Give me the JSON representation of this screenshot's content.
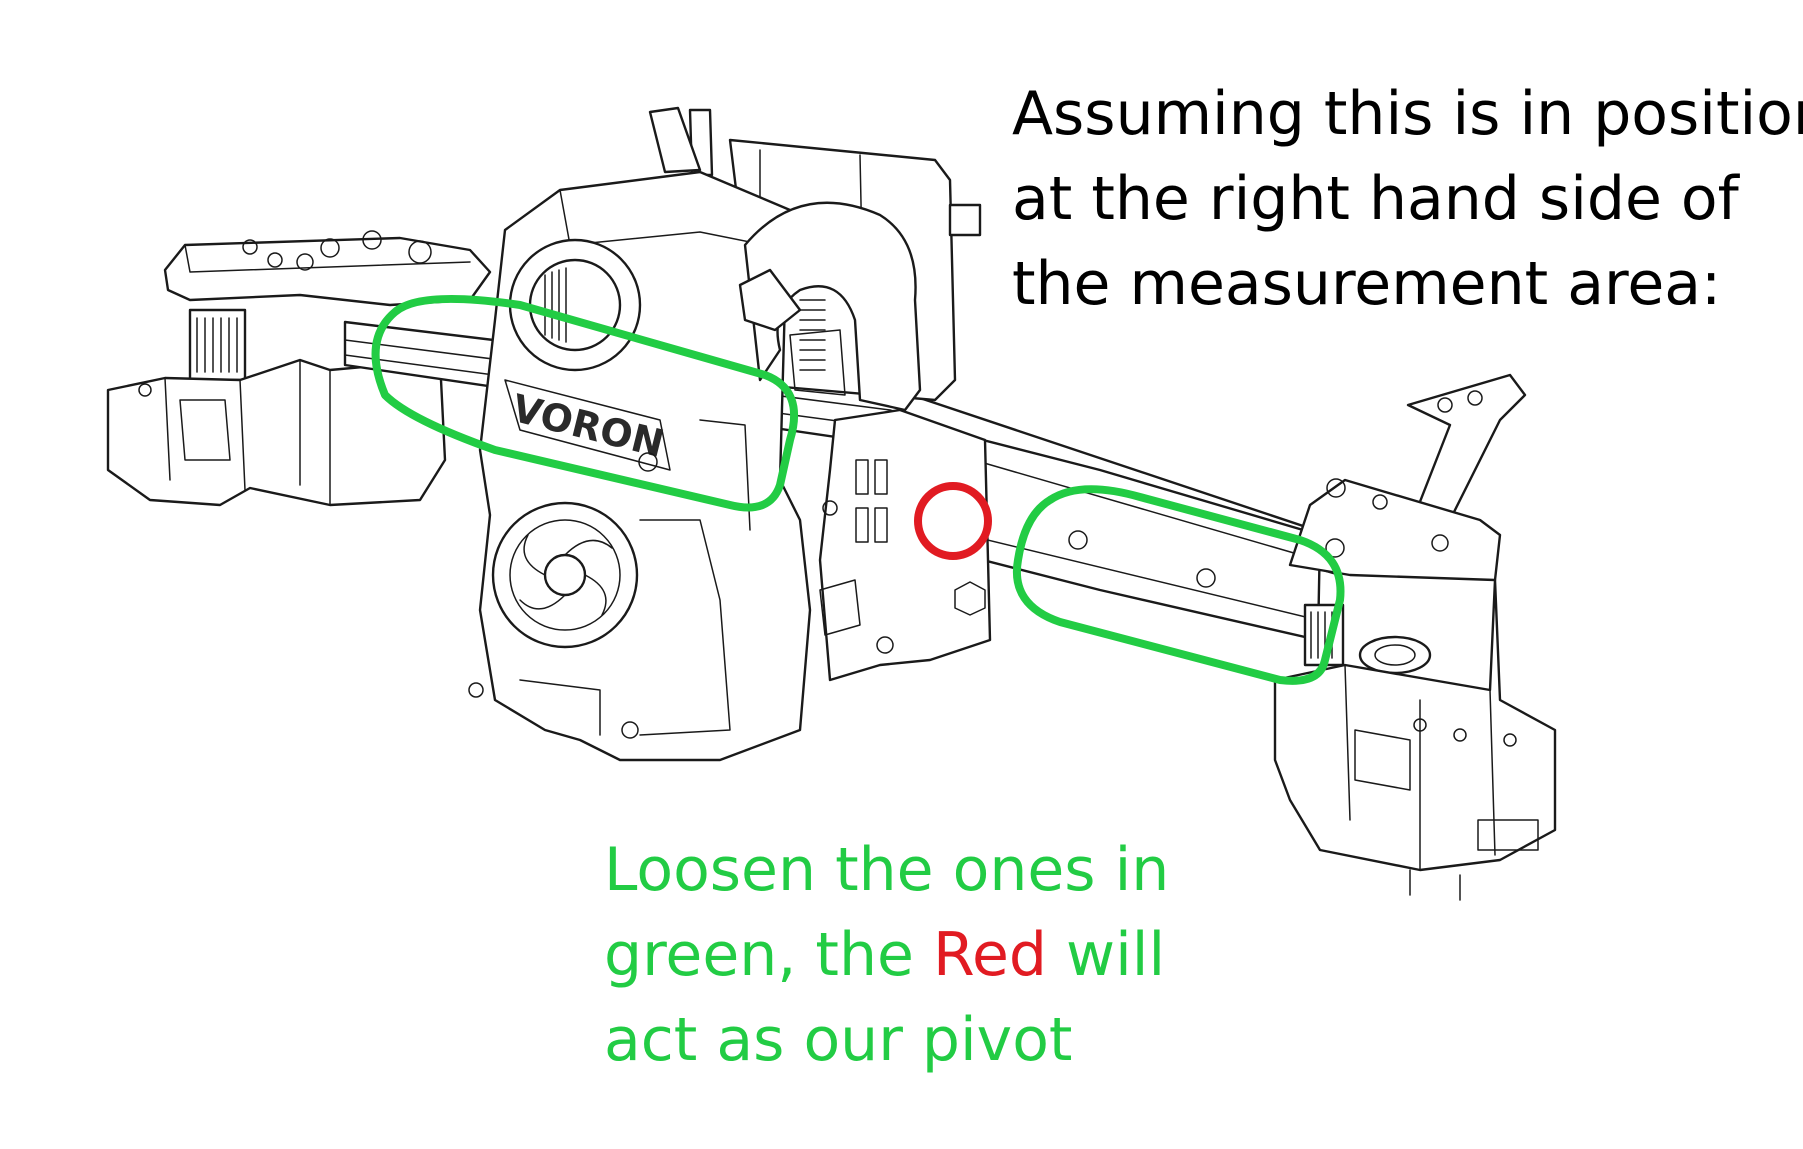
{
  "top_note": {
    "lines": [
      "Assuming this is in position",
      "at the right hand side of",
      "the measurement area:"
    ]
  },
  "bottom_note": {
    "line1": "Loosen the ones in",
    "line2_before": "green, the ",
    "line2_red": "Red",
    "line2_after": " will",
    "line3": "act as our pivot"
  },
  "part_markings": {
    "logo_text": "VORON"
  },
  "colors": {
    "green_highlight": "#22cc44",
    "red_highlight": "#e11b22",
    "line_art": "#1a1a1a"
  },
  "icons": [
    "printer-toolhead-drawing",
    "green-loop-left",
    "green-loop-right",
    "red-pivot-circle"
  ]
}
